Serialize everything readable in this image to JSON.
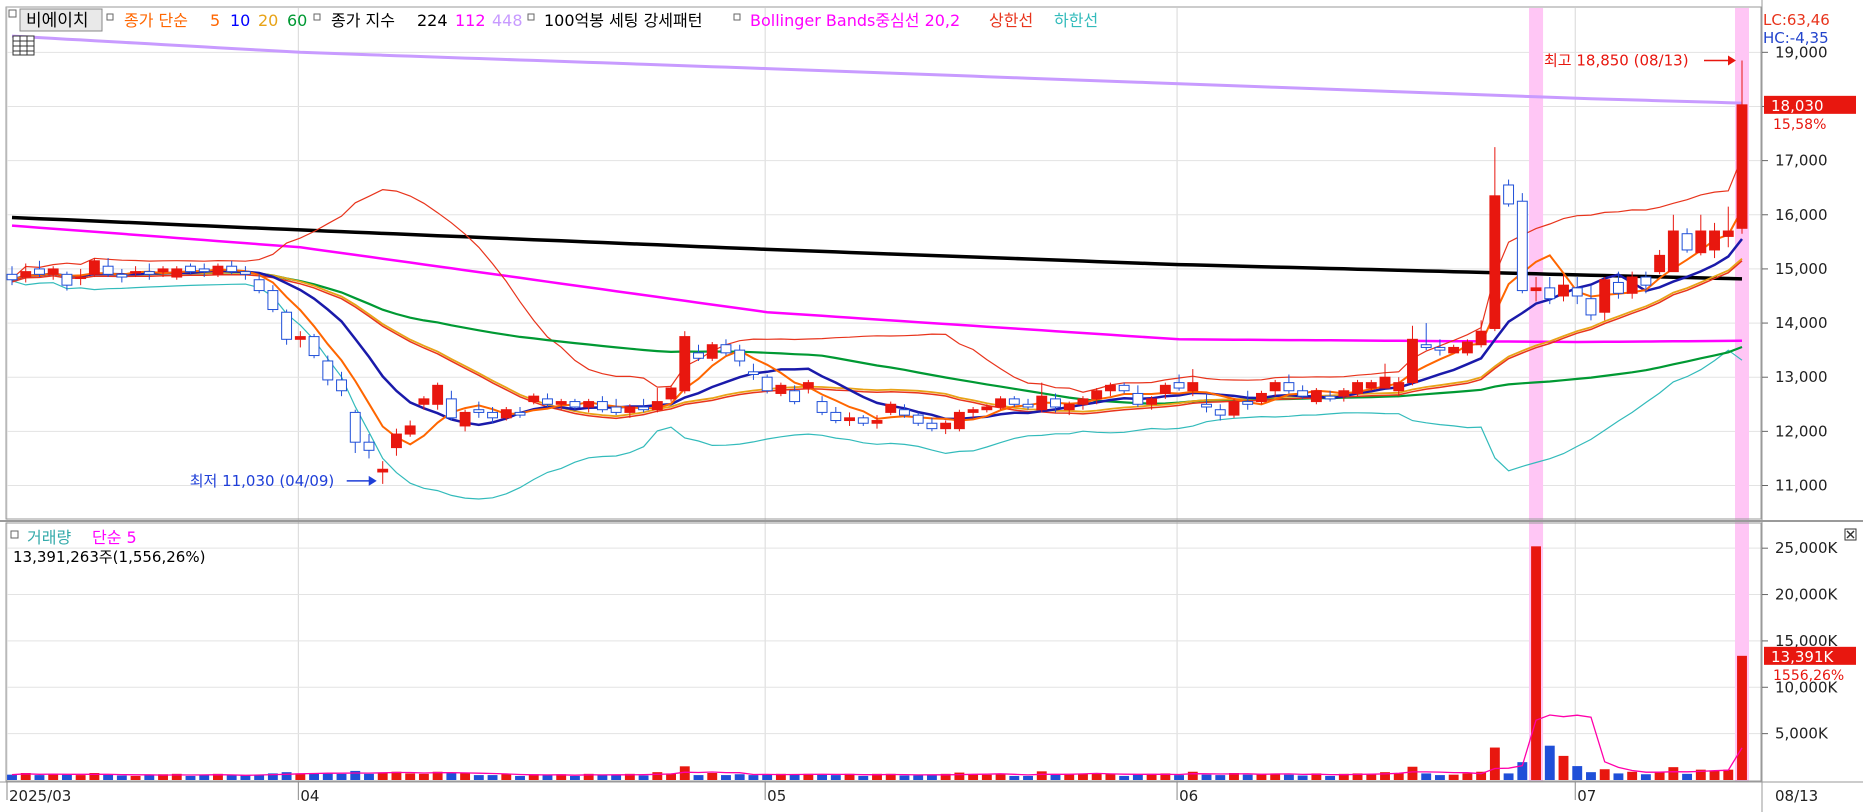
{
  "legend": {
    "stock_name": "비에이치",
    "ma_label": "종가 단순",
    "ma_periods": [
      "5",
      "10",
      "20",
      "60"
    ],
    "ma_colors": [
      "#ff6600",
      "#0000ff",
      "#e8a317",
      "#009933"
    ],
    "index_label": "종가 지수",
    "index_periods": [
      "224",
      "112",
      "448"
    ],
    "index_colors": [
      "#000000",
      "#ff00ff",
      "#c89bff"
    ],
    "pattern_label": "100억봉 세팅 강세패턴",
    "bb_label": "Bollinger Bands중심선 20,2",
    "bb_upper": "상한선",
    "bb_lower": "하한선"
  },
  "right_info": {
    "lc": "LC:63,46",
    "hc": "HC:-4,35"
  },
  "price_tag": {
    "value": "18,030",
    "pct": "15,58%"
  },
  "volume_tag": {
    "value": "13,391K",
    "pct": "1556,26%"
  },
  "volume_panel": {
    "title": "거래량",
    "ma_label": "단순 5",
    "summary": "13,391,263주(1,556,26%)"
  },
  "annotations": {
    "high": "최고 18,850 (08/13)",
    "low": "최저 11,030 (04/09)"
  },
  "x_axis": {
    "labels": [
      "2025/03",
      "04",
      "05",
      "06",
      "07",
      "08"
    ],
    "last_date": "08/13"
  },
  "chart_data": [
    {
      "type": "candlestick",
      "title": "",
      "y_ticks": [
        11000,
        12000,
        13000,
        14000,
        15000,
        16000,
        17000,
        18000,
        19000
      ],
      "y_tick_labels": [
        "11,000",
        "12,000",
        "13,000",
        "14,000",
        "15,000",
        "16,000",
        "17,000",
        "18,000",
        "19,000"
      ],
      "ylim": [
        10400,
        19800
      ],
      "months": [
        "2025/03",
        "04",
        "05",
        "06",
        "07",
        "08"
      ],
      "candles": [
        [
          14900,
          15050,
          14700,
          14800
        ],
        [
          14850,
          15100,
          14750,
          14950
        ],
        [
          15000,
          15150,
          14850,
          14900
        ],
        [
          14900,
          15050,
          14800,
          15000
        ],
        [
          14900,
          14950,
          14600,
          14700
        ],
        [
          14850,
          15000,
          14700,
          14850
        ],
        [
          14900,
          15200,
          14850,
          15150
        ],
        [
          15050,
          15200,
          14850,
          14900
        ],
        [
          14900,
          15000,
          14750,
          14850
        ],
        [
          14950,
          15050,
          14850,
          14950
        ],
        [
          14950,
          15100,
          14800,
          14900
        ],
        [
          14950,
          15050,
          14850,
          15000
        ],
        [
          14850,
          15050,
          14800,
          15000
        ],
        [
          15050,
          15100,
          14900,
          14950
        ],
        [
          15000,
          15100,
          14850,
          14950
        ],
        [
          14900,
          15100,
          14850,
          15050
        ],
        [
          15050,
          15150,
          14900,
          14950
        ],
        [
          14950,
          15050,
          14800,
          14900
        ],
        [
          14800,
          14900,
          14550,
          14600
        ],
        [
          14600,
          14700,
          14200,
          14250
        ],
        [
          14200,
          14250,
          13600,
          13700
        ],
        [
          13700,
          13850,
          13550,
          13750
        ],
        [
          13750,
          13800,
          13350,
          13400
        ],
        [
          13300,
          13400,
          12850,
          12950
        ],
        [
          12950,
          13100,
          12650,
          12750
        ],
        [
          12350,
          12400,
          11600,
          11800
        ],
        [
          11800,
          11950,
          11500,
          11650
        ],
        [
          11250,
          11450,
          11030,
          11300
        ],
        [
          11700,
          12050,
          11550,
          11950
        ],
        [
          11950,
          12200,
          11900,
          12100
        ],
        [
          12500,
          12650,
          12400,
          12600
        ],
        [
          12500,
          12900,
          12400,
          12850
        ],
        [
          12600,
          12750,
          12200,
          12250
        ],
        [
          12100,
          12400,
          12000,
          12350
        ],
        [
          12400,
          12550,
          12250,
          12350
        ],
        [
          12350,
          12450,
          12150,
          12250
        ],
        [
          12250,
          12450,
          12200,
          12400
        ],
        [
          12350,
          12450,
          12250,
          12300
        ],
        [
          12550,
          12700,
          12500,
          12650
        ],
        [
          12600,
          12700,
          12450,
          12500
        ],
        [
          12500,
          12600,
          12400,
          12550
        ],
        [
          12550,
          12600,
          12400,
          12450
        ],
        [
          12450,
          12600,
          12350,
          12550
        ],
        [
          12550,
          12650,
          12350,
          12400
        ],
        [
          12450,
          12600,
          12300,
          12350
        ],
        [
          12350,
          12500,
          12250,
          12450
        ],
        [
          12450,
          12600,
          12350,
          12400
        ],
        [
          12400,
          12800,
          12350,
          12550
        ],
        [
          12600,
          12850,
          12550,
          12800
        ],
        [
          12750,
          13850,
          12700,
          13750
        ],
        [
          13450,
          13600,
          13300,
          13350
        ],
        [
          13350,
          13650,
          13300,
          13600
        ],
        [
          13600,
          13700,
          13400,
          13450
        ],
        [
          13500,
          13600,
          13200,
          13300
        ],
        [
          13100,
          13250,
          12950,
          13050
        ],
        [
          13000,
          13050,
          12700,
          12750
        ],
        [
          12700,
          12900,
          12650,
          12850
        ],
        [
          12750,
          12850,
          12500,
          12550
        ],
        [
          12800,
          12950,
          12700,
          12900
        ],
        [
          12550,
          12650,
          12300,
          12350
        ],
        [
          12350,
          12450,
          12150,
          12200
        ],
        [
          12200,
          12350,
          12100,
          12250
        ],
        [
          12250,
          12300,
          12100,
          12150
        ],
        [
          12150,
          12300,
          12050,
          12200
        ],
        [
          12350,
          12550,
          12300,
          12500
        ],
        [
          12400,
          12500,
          12250,
          12300
        ],
        [
          12300,
          12350,
          12100,
          12150
        ],
        [
          12150,
          12250,
          12000,
          12050
        ],
        [
          12050,
          12200,
          11950,
          12150
        ],
        [
          12050,
          12400,
          12000,
          12350
        ],
        [
          12350,
          12450,
          12250,
          12400
        ],
        [
          12400,
          12500,
          12350,
          12450
        ],
        [
          12450,
          12650,
          12400,
          12600
        ],
        [
          12600,
          12650,
          12450,
          12500
        ],
        [
          12500,
          12600,
          12400,
          12450
        ],
        [
          12400,
          12900,
          12350,
          12650
        ],
        [
          12600,
          12700,
          12350,
          12450
        ],
        [
          12400,
          12550,
          12300,
          12500
        ],
        [
          12500,
          12650,
          12400,
          12600
        ],
        [
          12600,
          12800,
          12500,
          12750
        ],
        [
          12750,
          12900,
          12650,
          12850
        ],
        [
          12850,
          12900,
          12700,
          12750
        ],
        [
          12700,
          12850,
          12450,
          12500
        ],
        [
          12500,
          12650,
          12400,
          12600
        ],
        [
          12700,
          12900,
          12600,
          12850
        ],
        [
          12900,
          13050,
          12750,
          12800
        ],
        [
          12750,
          13150,
          12650,
          12900
        ],
        [
          12500,
          12700,
          12350,
          12450
        ],
        [
          12400,
          12500,
          12200,
          12300
        ],
        [
          12300,
          12600,
          12250,
          12550
        ],
        [
          12550,
          12750,
          12400,
          12500
        ],
        [
          12550,
          12750,
          12500,
          12700
        ],
        [
          12750,
          12950,
          12650,
          12900
        ],
        [
          12900,
          13050,
          12700,
          12750
        ],
        [
          12750,
          12850,
          12600,
          12650
        ],
        [
          12550,
          12800,
          12500,
          12750
        ],
        [
          12650,
          12750,
          12550,
          12600
        ],
        [
          12650,
          12800,
          12550,
          12750
        ],
        [
          12700,
          12950,
          12650,
          12900
        ],
        [
          12800,
          12950,
          12750,
          12900
        ],
        [
          12800,
          13250,
          12800,
          13000
        ],
        [
          12750,
          13000,
          12650,
          12900
        ],
        [
          12900,
          13950,
          12850,
          13700
        ],
        [
          13600,
          14000,
          13500,
          13550
        ],
        [
          13550,
          13700,
          13400,
          13500
        ],
        [
          13450,
          13600,
          13450,
          13550
        ],
        [
          13450,
          13700,
          13400,
          13650
        ],
        [
          13600,
          14050,
          13550,
          13850
        ],
        [
          13900,
          17250,
          13850,
          16350
        ],
        [
          16550,
          16650,
          16150,
          16200
        ],
        [
          16250,
          16400,
          14550,
          14600
        ],
        [
          14600,
          14850,
          14400,
          14650
        ],
        [
          14650,
          14850,
          14350,
          14450
        ],
        [
          14500,
          14900,
          14400,
          14700
        ],
        [
          14650,
          14850,
          14350,
          14500
        ],
        [
          14450,
          14700,
          14050,
          14150
        ],
        [
          14200,
          14850,
          14050,
          14800
        ],
        [
          14750,
          14950,
          14450,
          14550
        ],
        [
          14550,
          14950,
          14450,
          14850
        ],
        [
          14850,
          14950,
          14550,
          14700
        ],
        [
          14950,
          15350,
          14900,
          15250
        ],
        [
          14950,
          16000,
          14950,
          15700
        ],
        [
          15650,
          15750,
          15300,
          15350
        ],
        [
          15300,
          16000,
          15250,
          15700
        ],
        [
          15350,
          15850,
          15200,
          15700
        ],
        [
          15600,
          16150,
          15400,
          15700
        ],
        [
          15750,
          18850,
          15650,
          18030
        ]
      ],
      "ma_index_series": [
        {
          "name": "224",
          "values_at_months": [
            15950,
            15720,
            15360,
            15080,
            14890,
            14730,
            14650
          ]
        },
        {
          "name": "112",
          "values_at_months": [
            15800,
            15400,
            14200,
            13700,
            13650,
            13700,
            14250
          ]
        },
        {
          "name": "448",
          "values_at_months": [
            19300,
            19000,
            18700,
            18420,
            18150,
            17960,
            17850
          ]
        }
      ],
      "price_markers": {
        "high": 18850,
        "low": 11030,
        "last": 18030
      }
    },
    {
      "type": "bar",
      "title": "",
      "y_ticks": [
        5000,
        10000,
        15000,
        20000,
        25000
      ],
      "y_tick_labels": [
        "5,000K",
        "10,000K",
        "15,000K",
        "20,000K",
        "25,000K"
      ],
      "ylim": [
        0,
        27500
      ],
      "unit": "K",
      "spike_values": {
        "jul_spike": 25200,
        "last": 13391
      },
      "ma5_peak": 6600
    }
  ]
}
